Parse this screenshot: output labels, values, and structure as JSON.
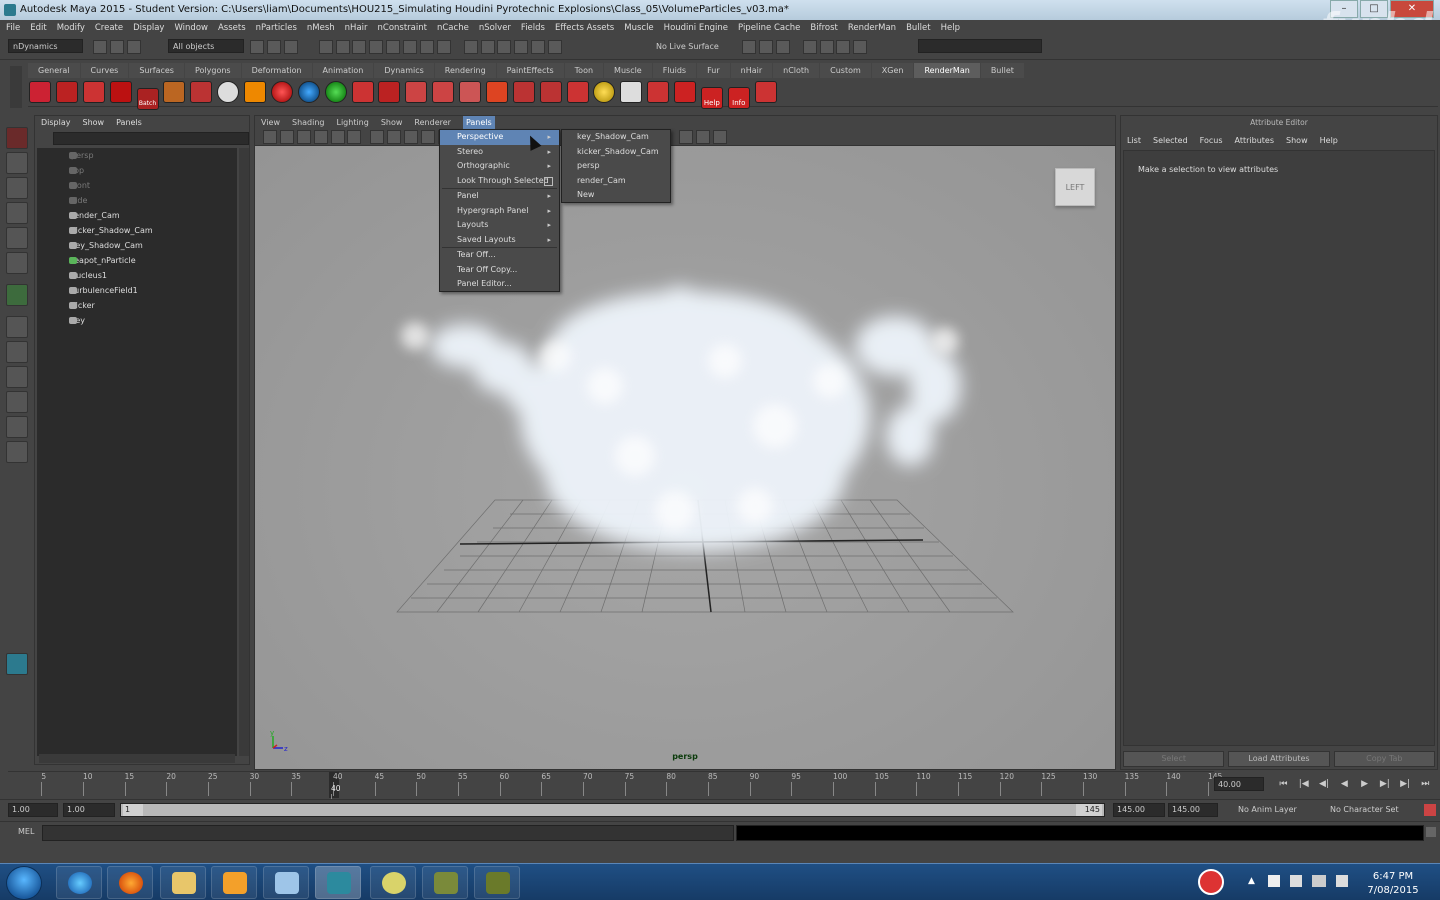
{
  "window": {
    "title": "Autodesk Maya 2015 - Student Version: C:\\Users\\liam\\Documents\\HOU215_Simulating Houdini Pyrotechnic Explosions\\Class_05\\VolumeParticles_v03.ma*",
    "watermark": "fxphd",
    "controls": {
      "minimize": "–",
      "maximize": "□",
      "close": "✕"
    }
  },
  "menubar": [
    "File",
    "Edit",
    "Modify",
    "Create",
    "Display",
    "Window",
    "Assets",
    "nParticles",
    "nMesh",
    "nHair",
    "nConstraint",
    "nCache",
    "nSolver",
    "Fields",
    "Effects Assets",
    "Muscle",
    "Houdini Engine",
    "Pipeline Cache",
    "Bifrost",
    "RenderMan",
    "Bullet",
    "Help"
  ],
  "statusline": {
    "menuset": "nDynamics",
    "selection_mask": "All objects",
    "live_surface": "No Live Surface"
  },
  "shelf_tabs": [
    "General",
    "Curves",
    "Surfaces",
    "Polygons",
    "Deformation",
    "Animation",
    "Dynamics",
    "Rendering",
    "PaintEffects",
    "Toon",
    "Muscle",
    "Fluids",
    "Fur",
    "nHair",
    "nCloth",
    "Custom",
    "XGen",
    "RenderMan",
    "Bullet"
  ],
  "shelf_active": "RenderMan",
  "shelf_icon_labels": {
    "batch": "Batch",
    "help": "Help",
    "info": "Info"
  },
  "outliner": {
    "menu": [
      "Display",
      "Show",
      "Panels"
    ],
    "items": [
      {
        "label": "persp",
        "dim": true
      },
      {
        "label": "top",
        "dim": true
      },
      {
        "label": "front",
        "dim": true
      },
      {
        "label": "side",
        "dim": true
      },
      {
        "label": "render_Cam",
        "dim": false
      },
      {
        "label": "kicker_Shadow_Cam",
        "dim": false
      },
      {
        "label": "key_Shadow_Cam",
        "dim": false
      },
      {
        "label": "teapot_nParticle",
        "dim": false
      },
      {
        "label": "nucleus1",
        "dim": false
      },
      {
        "label": "turbulenceField1",
        "dim": false
      },
      {
        "label": "kicker",
        "dim": false
      },
      {
        "label": "key",
        "dim": false
      }
    ]
  },
  "viewport": {
    "menu": [
      "View",
      "Shading",
      "Lighting",
      "Show",
      "Renderer",
      "Panels"
    ],
    "active_menu": "Panels",
    "camera_label": "persp",
    "viewcube_label": "LEFT",
    "axis": {
      "y": "y",
      "z": "z"
    }
  },
  "panels_menu": {
    "items": [
      {
        "label": "Perspective",
        "submenu": true,
        "highlight": true
      },
      {
        "label": "Stereo",
        "submenu": true
      },
      {
        "label": "Orthographic",
        "submenu": true
      },
      {
        "label": "Look Through Selected",
        "checkbox": true
      },
      {
        "label": "Panel",
        "submenu": true
      },
      {
        "label": "Hypergraph Panel",
        "submenu": true
      },
      {
        "label": "Layouts",
        "submenu": true
      },
      {
        "label": "Saved Layouts",
        "submenu": true
      },
      {
        "label": "Tear Off..."
      },
      {
        "label": "Tear Off Copy..."
      },
      {
        "label": "Panel Editor..."
      }
    ],
    "perspective_submenu": [
      "key_Shadow_Cam",
      "kicker_Shadow_Cam",
      "persp",
      "render_Cam",
      "New"
    ]
  },
  "attribute_editor": {
    "title": "Attribute Editor",
    "menu": [
      "List",
      "Selected",
      "Focus",
      "Attributes",
      "Show",
      "Help"
    ],
    "message": "Make a selection to view attributes",
    "buttons": [
      "Select",
      "Load Attributes",
      "Copy Tab"
    ]
  },
  "timeline": {
    "ticks": [
      5,
      10,
      15,
      20,
      25,
      30,
      35,
      40,
      45,
      50,
      55,
      60,
      65,
      70,
      75,
      80,
      85,
      90,
      95,
      100,
      105,
      110,
      115,
      120,
      125,
      130,
      135,
      140,
      145
    ],
    "current_frame": 40,
    "current_field": "40.00"
  },
  "range": {
    "start": "1.00",
    "playback_start": "1.00",
    "slider_start": "1",
    "slider_end": "145",
    "playback_end": "145.00",
    "end": "145.00",
    "anim_layer": "No Anim Layer",
    "character_set": "No Character Set"
  },
  "mel": {
    "label": "MEL"
  },
  "taskbar": {
    "time": "6:47 PM",
    "date": "7/08/2015"
  }
}
